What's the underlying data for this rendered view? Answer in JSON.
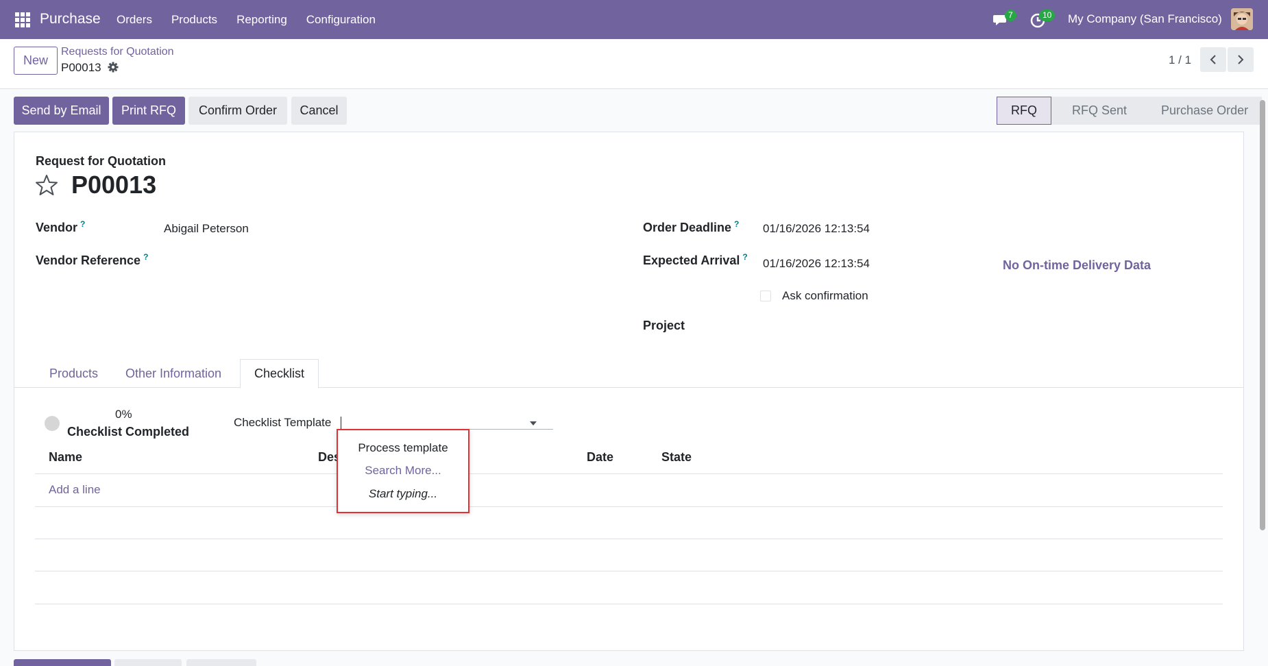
{
  "navbar": {
    "brand": "Purchase",
    "menu": [
      "Orders",
      "Products",
      "Reporting",
      "Configuration"
    ],
    "messages_count": "7",
    "activities_count": "10",
    "company": "My Company (San Francisco)"
  },
  "control": {
    "new_label": "New",
    "breadcrumb_parent": "Requests for Quotation",
    "breadcrumb_current": "P00013",
    "pager": "1 / 1"
  },
  "actions": {
    "send_email": "Send by Email",
    "print_rfq": "Print RFQ",
    "confirm_order": "Confirm Order",
    "cancel": "Cancel"
  },
  "status_stages": [
    "RFQ",
    "RFQ Sent",
    "Purchase Order"
  ],
  "status_active": "RFQ",
  "form": {
    "doc_type": "Request for Quotation",
    "name": "P00013",
    "vendor_label": "Vendor",
    "vendor_value": "Abigail Peterson",
    "vendor_ref_label": "Vendor Reference",
    "order_deadline_label": "Order Deadline",
    "order_deadline_value": "01/16/2026 12:13:54",
    "expected_arrival_label": "Expected Arrival",
    "expected_arrival_value": "01/16/2026 12:13:54",
    "otd_label": "No On-time Delivery Data",
    "ask_confirmation_label": "Ask confirmation",
    "project_label": "Project",
    "help_mark": "?"
  },
  "tabs": [
    "Products",
    "Other Information",
    "Checklist"
  ],
  "active_tab": "Checklist",
  "checklist": {
    "percent": "0%",
    "completed_label": "Checklist Completed",
    "template_label": "Checklist Template",
    "columns": [
      "Name",
      "Des",
      "Date",
      "State"
    ],
    "add_line": "Add a line"
  },
  "autocomplete": {
    "items": [
      "Process template",
      "Search More...",
      "Start typing..."
    ]
  },
  "colors": {
    "brand": "#71639e",
    "badge": "#28a745",
    "highlight_border": "#e03232"
  }
}
